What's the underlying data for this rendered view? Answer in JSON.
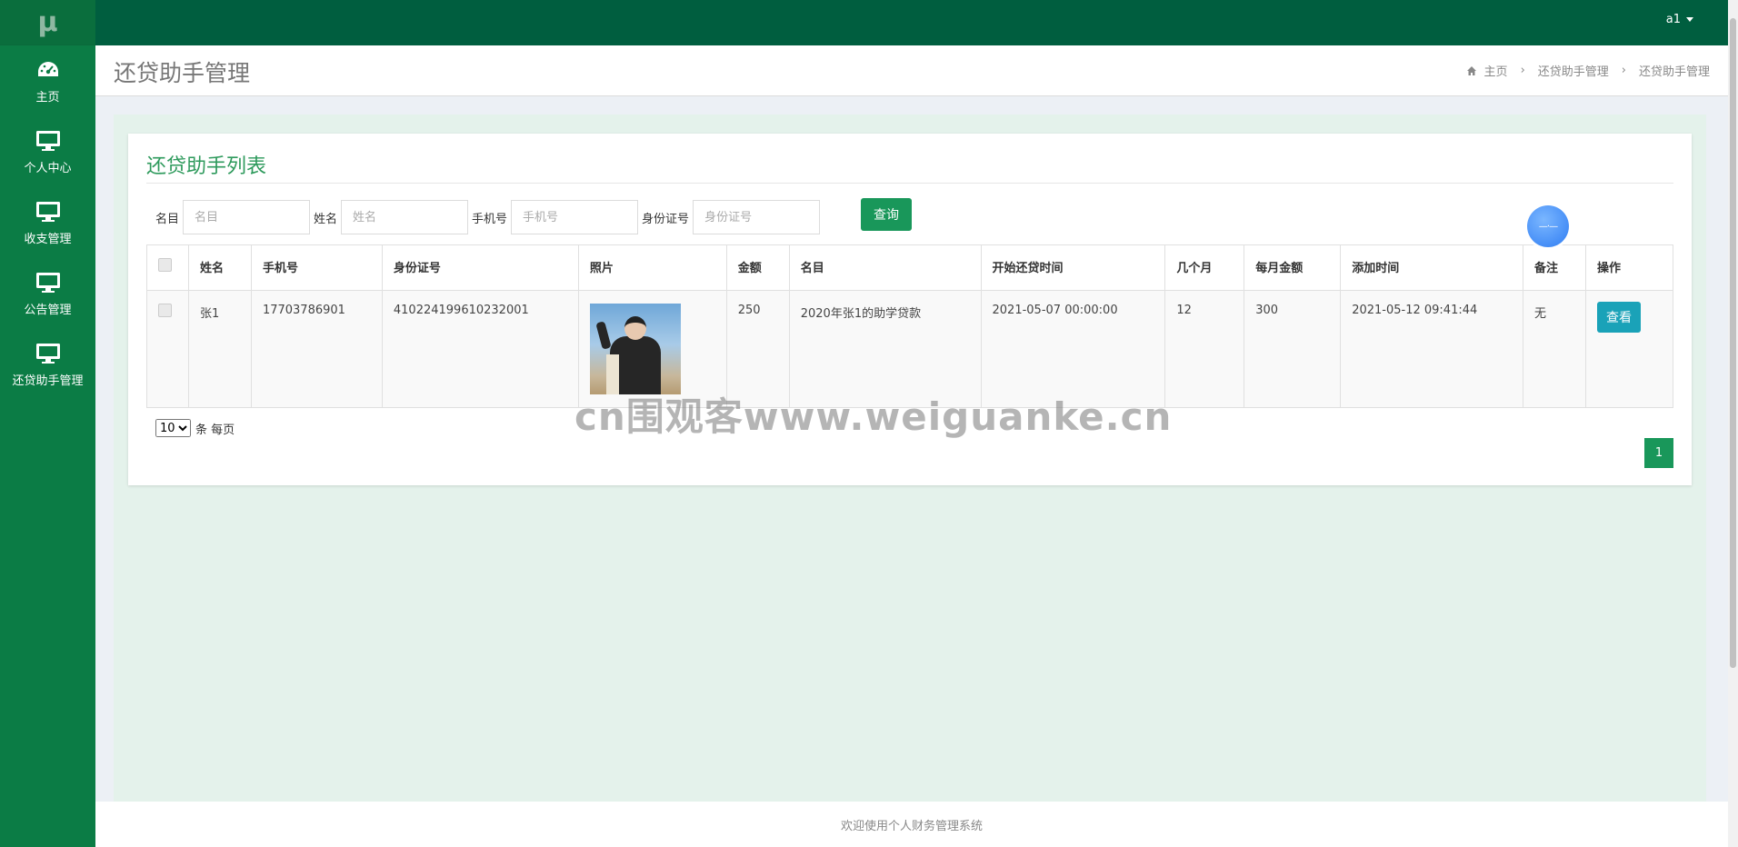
{
  "logo": "μ",
  "sidebar": {
    "items": [
      {
        "label": "主页",
        "icon": "dashboard-icon"
      },
      {
        "label": "个人中心",
        "icon": "monitor-icon"
      },
      {
        "label": "收支管理",
        "icon": "monitor-icon"
      },
      {
        "label": "公告管理",
        "icon": "monitor-icon"
      },
      {
        "label": "还贷助手管理",
        "icon": "monitor-icon"
      }
    ]
  },
  "topbar": {
    "user": "a1"
  },
  "header": {
    "title": "还贷助手管理",
    "breadcrumb": [
      "主页",
      "还贷助手管理",
      "还贷助手管理"
    ]
  },
  "box": {
    "title": "还贷助手列表"
  },
  "search": {
    "fields": [
      {
        "label": "名目",
        "placeholder": "名目"
      },
      {
        "label": "姓名",
        "placeholder": "姓名"
      },
      {
        "label": "手机号",
        "placeholder": "手机号"
      },
      {
        "label": "身份证号",
        "placeholder": "身份证号"
      }
    ],
    "button": "查询"
  },
  "table": {
    "headers": [
      "姓名",
      "手机号",
      "身份证号",
      "照片",
      "金额",
      "名目",
      "开始还贷时间",
      "几个月",
      "每月金额",
      "添加时间",
      "备注",
      "操作"
    ],
    "rows": [
      {
        "name": "张1",
        "phone": "17703786901",
        "id_number": "410224199610232001",
        "amount": "250",
        "item": "2020年张1的助学贷款",
        "start_time": "2021-05-07 00:00:00",
        "months": "12",
        "monthly": "300",
        "added": "2021-05-12 09:41:44",
        "note": "无",
        "action": "查看"
      }
    ]
  },
  "pagination": {
    "page_size": "10",
    "page_size_suffix": "条 每页",
    "current": "1"
  },
  "watermark": "cn围观客www.weiguanke.cn",
  "footer": "欢迎使用个人财务管理系统",
  "colors": {
    "sidebar": "#0b7c45",
    "topbar": "#005e3f",
    "accent": "#19975a",
    "view_button": "#1aa2b8"
  }
}
